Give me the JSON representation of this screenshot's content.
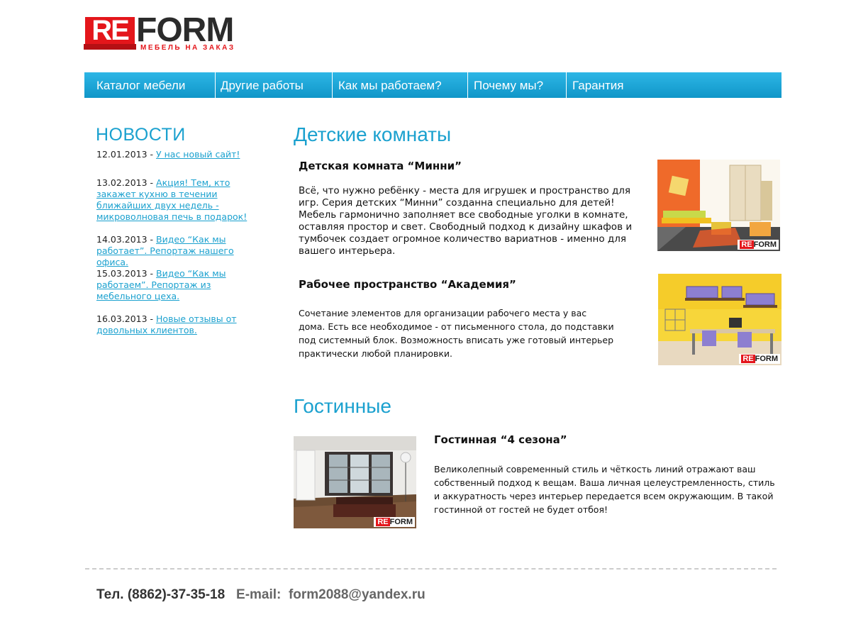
{
  "logo": {
    "re": "RE",
    "form": "FORM",
    "tagline": "МЕБЕЛЬ НА ЗАКАЗ"
  },
  "nav": [
    "Каталог мебели",
    "Другие работы",
    "Как мы работаем?",
    "Почему мы?",
    "Гарантия"
  ],
  "news": {
    "title": "НОВОСТИ",
    "items": [
      {
        "date": "12.01.2013 - ",
        "link": "У нас новый сайт!"
      },
      {
        "date": "13.02.2013 - ",
        "link": "Акция! Тем, кто закажет кухню в течении ближайших двух недель - микроволновая печь в подарок!"
      },
      {
        "date": "14.03.2013 - ",
        "link": "Видео “Как мы работает”. Репортаж нашего офиса."
      },
      {
        "date": "15.03.2013 - ",
        "link": "Видео “Как мы работаем”. Репортаж из мебельного цеха."
      },
      {
        "date": "16.03.2013 - ",
        "link": "Новые отзывы от довольных клиентов."
      }
    ]
  },
  "sections": {
    "kids": {
      "title": "Детские  комнаты",
      "item1": {
        "title": "Детская комната “Минни”",
        "text": "Всё, что нужно ребёнку - места для игрушек и пространство для игр. Серия детских “Минни” созданна специально для детей! Мебель гармонично заполняет все свободные уголки в комнате, оставляя простор и свет. Свободный подход к дизайну шкафов и тумбочек создает огромное количество вариатнов - именно для вашего интерьера."
      },
      "item2": {
        "title": "Рабочее пространство “Академия”",
        "text": "Сочетание элементов для организации рабочего места у вас дома. Есть все необходимое - от письменного стола, до подставки под системный блок.  Возможность вписать уже готовый интерьер практически любой планировки."
      }
    },
    "living": {
      "title": "Гостинные",
      "item1": {
        "title": "Гостинная “4 сезона”",
        "text": "Великолепный современный стиль и чёткость линий отражают ваш собственный подход к вещам. Ваша личная целеустремленность, стиль и аккуратность через интерьер передается всем окружающим. В такой гостинной от гостей не будет отбоя!"
      }
    }
  },
  "photo_badge": {
    "re": "RE",
    "form": "FORM"
  },
  "footer": {
    "phone_label": "Тел.",
    "phone": "(8862)-37-35-18",
    "email_label": "E-mail:",
    "email": "form2088@yandex.ru"
  }
}
